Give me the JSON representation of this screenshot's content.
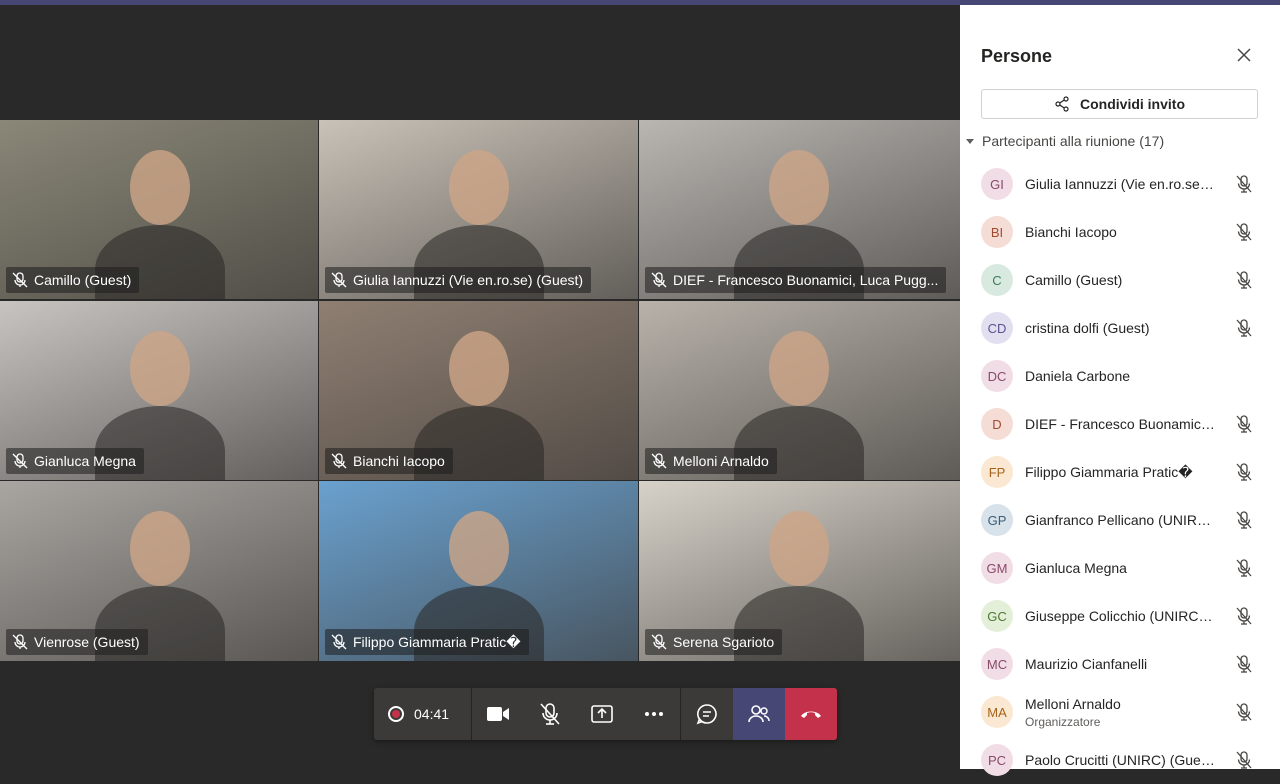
{
  "call": {
    "timer": "04:41",
    "controls": [
      "camera-icon",
      "mic-off-icon",
      "share-screen-icon",
      "more-icon",
      "chat-icon",
      "participants-icon",
      "hang-up-icon"
    ]
  },
  "tiles": [
    {
      "name": "Camillo (Guest)",
      "bg": "#8a8778"
    },
    {
      "name": "Giulia Iannuzzi (Vie en.ro.se) (Guest)",
      "bg": "#c9c2b8"
    },
    {
      "name": "DIEF - Francesco Buonamici, Luca Pugg...",
      "bg": "#b9b6b2"
    },
    {
      "name": "Gianluca Megna",
      "bg": "#c8c4c2"
    },
    {
      "name": "Bianchi Iacopo",
      "bg": "#8f7f72"
    },
    {
      "name": "Melloni Arnaldo",
      "bg": "#b8b2aa"
    },
    {
      "name": "Vienrose (Guest)",
      "bg": "#a9a6a2"
    },
    {
      "name": "Filippo Giammaria Pratic�",
      "bg": "#6aa1cf"
    },
    {
      "name": "Serena Sgarioto",
      "bg": "#d7d2c9"
    }
  ],
  "panel": {
    "title": "Persone",
    "share_label": "Condividi invito",
    "section_label": "Partecipanti alla riunione (17)"
  },
  "participants": [
    {
      "initials": "GI",
      "name": "Giulia Iannuzzi (Vie en.ro.se) ...",
      "role": "",
      "bg": "#f1dde6",
      "fg": "#8a4a68",
      "muted": true
    },
    {
      "initials": "BI",
      "name": "Bianchi Iacopo",
      "role": "",
      "bg": "#f5dcd5",
      "fg": "#a34b32",
      "muted": true
    },
    {
      "initials": "C",
      "name": "Camillo (Guest)",
      "role": "",
      "bg": "#d8eadf",
      "fg": "#3e7a55",
      "muted": true
    },
    {
      "initials": "CD",
      "name": "cristina dolfi (Guest)",
      "role": "",
      "bg": "#e2dff0",
      "fg": "#5b5391",
      "muted": true
    },
    {
      "initials": "DC",
      "name": "Daniela Carbone",
      "role": "",
      "bg": "#f1dde6",
      "fg": "#8a4a68",
      "muted": false
    },
    {
      "initials": "D",
      "name": "DIEF - Francesco Buonamici,...",
      "role": "",
      "bg": "#f5dcd5",
      "fg": "#a34b32",
      "muted": true
    },
    {
      "initials": "FP",
      "name": "Filippo Giammaria Pratic�",
      "role": "",
      "bg": "#fbe8d2",
      "fg": "#a2641c",
      "muted": true
    },
    {
      "initials": "GP",
      "name": "Gianfranco Pellicano (UNIRC...",
      "role": "",
      "bg": "#d7e2ea",
      "fg": "#3e5f78",
      "muted": true
    },
    {
      "initials": "GM",
      "name": "Gianluca Megna",
      "role": "",
      "bg": "#f1dde6",
      "fg": "#8a4a68",
      "muted": true
    },
    {
      "initials": "GC",
      "name": "Giuseppe Colicchio (UNIRC) ...",
      "role": "",
      "bg": "#e3efd9",
      "fg": "#4f7a30",
      "muted": true
    },
    {
      "initials": "MC",
      "name": "Maurizio Cianfanelli",
      "role": "",
      "bg": "#f1dde6",
      "fg": "#8a4a68",
      "muted": true
    },
    {
      "initials": "MA",
      "name": "Melloni Arnaldo",
      "role": "Organizzatore",
      "bg": "#fbe8d2",
      "fg": "#a2641c",
      "muted": true
    },
    {
      "initials": "PC",
      "name": "Paolo Crucitti (UNIRC) (Guest)",
      "role": "",
      "bg": "#f1dde6",
      "fg": "#8a4a68",
      "muted": true
    }
  ]
}
